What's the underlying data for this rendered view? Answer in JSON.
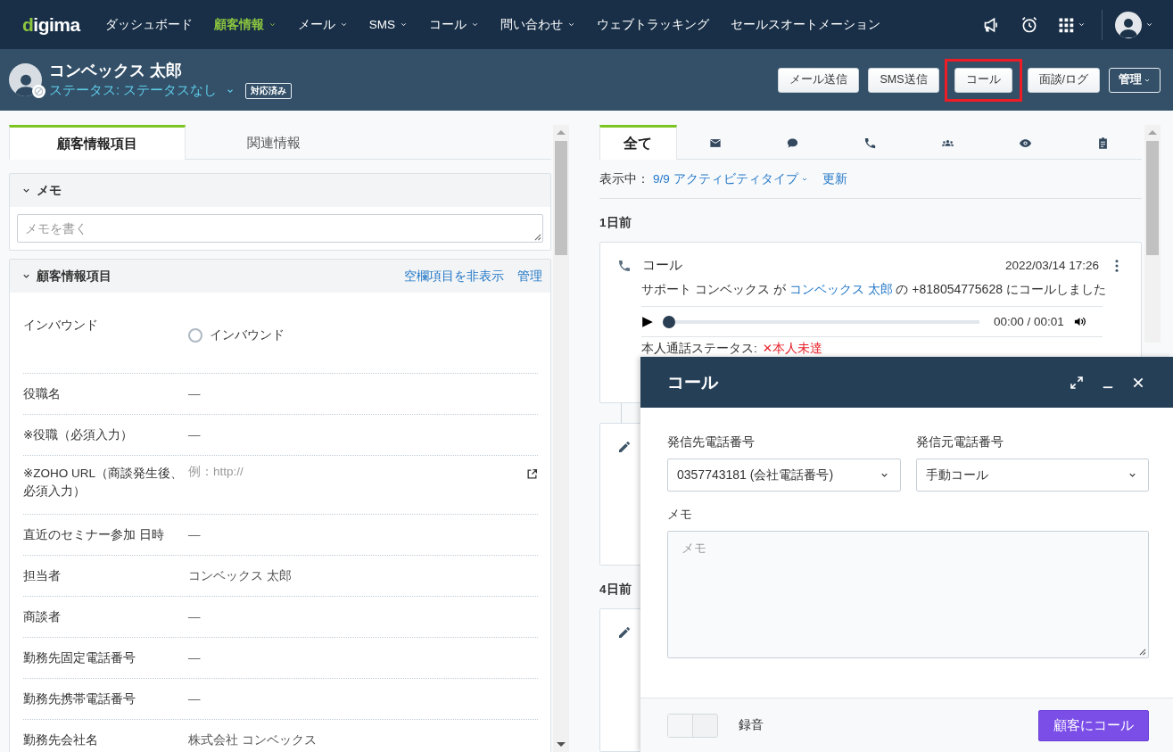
{
  "nav": {
    "logo": "digima",
    "items": [
      {
        "label": "ダッシュボード",
        "selected": false,
        "dropdown": false
      },
      {
        "label": "顧客情報",
        "selected": true,
        "dropdown": true
      },
      {
        "label": "メール",
        "selected": false,
        "dropdown": true
      },
      {
        "label": "SMS",
        "selected": false,
        "dropdown": true
      },
      {
        "label": "コール",
        "selected": false,
        "dropdown": true
      },
      {
        "label": "問い合わせ",
        "selected": false,
        "dropdown": true
      },
      {
        "label": "ウェブトラッキング",
        "selected": false,
        "dropdown": false
      },
      {
        "label": "セールスオートメーション",
        "selected": false,
        "dropdown": false
      }
    ]
  },
  "header": {
    "name": "コンベックス 太郎",
    "status": "ステータス: ステータスなし",
    "badge": "対応済み",
    "actions": [
      {
        "label": "メール送信",
        "kind": "light",
        "highlighted": false
      },
      {
        "label": "SMS送信",
        "kind": "light",
        "highlighted": false
      },
      {
        "label": "コール",
        "kind": "light",
        "highlighted": true
      },
      {
        "label": "面談/ログ",
        "kind": "light",
        "highlighted": false
      },
      {
        "label": "管理",
        "kind": "dark",
        "highlighted": false
      }
    ]
  },
  "info_panel": {
    "tabs": [
      {
        "label": "顧客情報項目",
        "selected": true
      },
      {
        "label": "関連情報",
        "selected": false
      }
    ],
    "memo": {
      "title": "メモ",
      "expanded": true,
      "placeholder": "メモを書く"
    },
    "fields_section": {
      "title": "顧客情報項目",
      "expanded": true,
      "links": [
        "空欄項目を非表示",
        "管理"
      ],
      "fields": [
        {
          "label": "インバウンド",
          "kind": "radio",
          "value": "インバウンド",
          "checked": false
        },
        {
          "label": "役職名",
          "kind": "text",
          "value": "—"
        },
        {
          "label": "※役職（必須入力）",
          "kind": "text",
          "value": "—"
        },
        {
          "label": "※ZOHO URL（商談発生後、必須入力）",
          "kind": "url",
          "placeholder": "例：http://"
        },
        {
          "label": "直近のセミナー参加 日時",
          "kind": "text",
          "value": "—"
        },
        {
          "label": "担当者",
          "kind": "text",
          "value": "コンベックス 太郎"
        },
        {
          "label": "商談者",
          "kind": "text",
          "value": "—"
        },
        {
          "label": "勤務先固定電話番号",
          "kind": "text",
          "value": "—"
        },
        {
          "label": "勤務先携帯電話番号",
          "kind": "text",
          "value": "—"
        },
        {
          "label": "勤務先会社名",
          "kind": "text",
          "value": "株式会社 コンベックス"
        }
      ]
    }
  },
  "activity_panel": {
    "tabs": [
      {
        "label": "全て",
        "selected": true
      },
      {
        "selected": false
      },
      {
        "selected": false
      },
      {
        "selected": false
      },
      {
        "selected": false
      },
      {
        "selected": false
      },
      {
        "selected": false
      }
    ],
    "filter": {
      "prefix": "表示中：",
      "value": "9/9 アクティビティタイプ",
      "refresh": "更新"
    },
    "groups": [
      {
        "date": "1日前",
        "items": [
          {
            "kind": "call",
            "title": "コール",
            "time": "2022/03/14 17:26",
            "actor": "サポート コンベックス が",
            "contact": "コンベックス 太郎",
            "rest": "の +818054775628 にコールしました",
            "player": {
              "level": 0,
              "time": "00:00 / 00:01"
            },
            "status_label": "本人通話ステータス:",
            "status_value": "✕本人未達"
          },
          {
            "kind": "note"
          }
        ]
      },
      {
        "date": "4日前",
        "items": [
          {
            "kind": "note"
          }
        ]
      }
    ]
  },
  "call_dialog": {
    "title": "コール",
    "fields": [
      {
        "label": "発信先電話番号",
        "value": "0357743181 (会社電話番号)"
      },
      {
        "label": "発信元電話番号",
        "value": "手動コール"
      }
    ],
    "memo_label": "メモ",
    "memo_placeholder": "メモ",
    "record": {
      "label": "録音",
      "on": false
    },
    "submit": "顧客にコール"
  }
}
